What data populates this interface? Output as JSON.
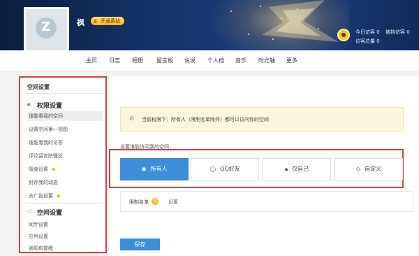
{
  "profile": {
    "nickname": "枫",
    "vip_label": "开通黄钻"
  },
  "visitor_stats": {
    "today_label": "今日访客 0",
    "blocked_label": "被挡访客 0",
    "total_label": "访客总量 0"
  },
  "nav": [
    "主页",
    "日志",
    "相册",
    "留言板",
    "说说",
    "个人档",
    "音乐",
    "时光轴",
    "更多"
  ],
  "sidebar": {
    "title": "空间设置",
    "group1": "权限设置",
    "group1_items": [
      "谁能看我的空间",
      "设置空间第一视图",
      "谁能看我的访客",
      "评论留言防骚扰",
      "隐身设置",
      "封存我的动态",
      "去广告设置"
    ],
    "group2": "空间设置",
    "group2_items": [
      "同步设置",
      "应用设置",
      "通知和提醒"
    ]
  },
  "notice": "当前权限下：所有人（限制名单除外）都可以访问你的空间",
  "choose_label": "设置谁能访问我的空间：",
  "options": [
    "所有人",
    "QQ好友",
    "仅自己",
    "自定义"
  ],
  "blacklist": {
    "label": "限制名单",
    "help": "?",
    "set": "设置"
  },
  "save_label": "保存"
}
